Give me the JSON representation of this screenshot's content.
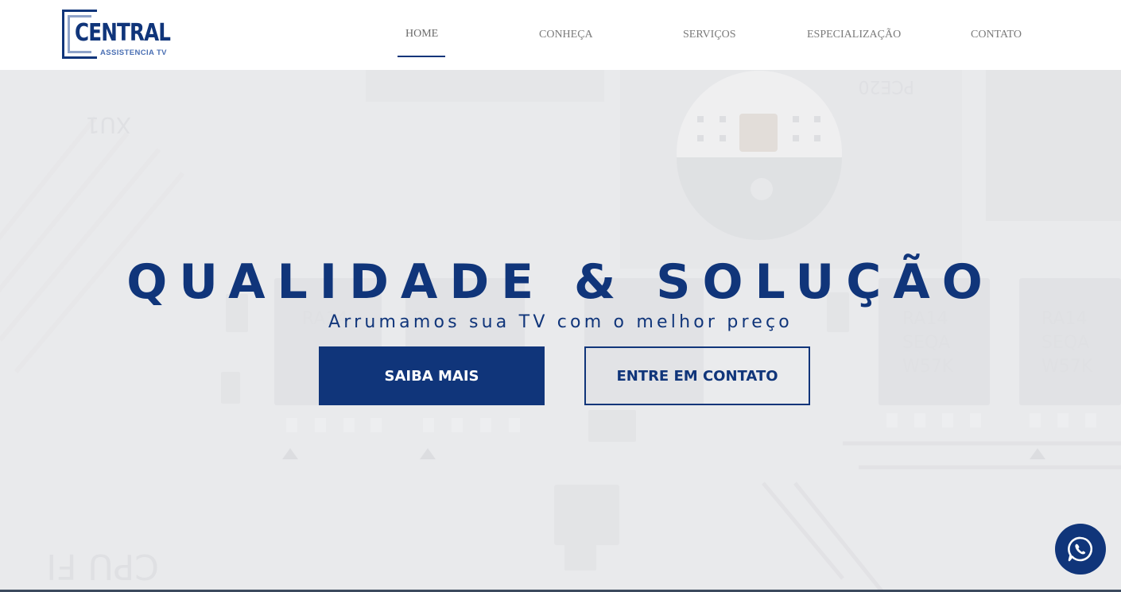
{
  "brand": {
    "name": "CENTRAL",
    "subtitle": "ASSISTENCIA TV",
    "primary_color": "#10357a"
  },
  "nav": {
    "items": [
      {
        "label": "HOME",
        "active": true
      },
      {
        "label": "CONHEÇA",
        "active": false
      },
      {
        "label": "SERVIÇOS",
        "active": false
      },
      {
        "label": "ESPECIALIZAÇÃO",
        "active": false
      },
      {
        "label": "CONTATO",
        "active": false
      }
    ]
  },
  "hero": {
    "title": "QUALIDADE & SOLUÇÃO",
    "subtitle": "Arrumamos sua TV com o melhor preço",
    "primary_button": "SAIBA MAIS",
    "secondary_button": "ENTRE EM CONTATO",
    "background_icon": "circuit-board-image"
  },
  "floating": {
    "icon": "whatsapp-icon"
  }
}
